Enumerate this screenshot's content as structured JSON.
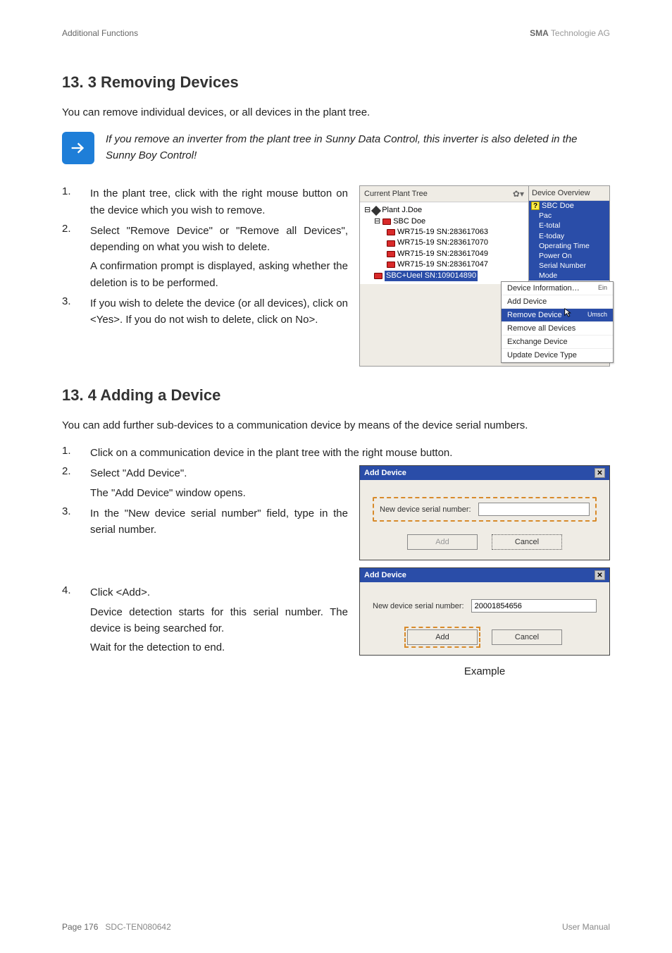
{
  "header": {
    "left": "Additional Functions",
    "right_bold": "SMA",
    "right_rest": " Technologie AG"
  },
  "section1": {
    "heading": "13. 3 Removing Devices",
    "intro": "You can remove individual devices, or all devices in the plant tree.",
    "note": "If you remove an inverter from the plant tree in Sunny Data Control, this inverter is also deleted in the Sunny Boy Control!",
    "steps": [
      {
        "n": "1.",
        "t": "In the plant tree, click with the right mouse button on the device which you wish to remove."
      },
      {
        "n": "2.",
        "t": "Select \"Remove Device\" or \"Remove all Devices\", depending on what you wish to delete.",
        "s": "A confirmation prompt is displayed, asking whether the deletion is to be performed."
      },
      {
        "n": "3.",
        "t": "If you wish to delete the device (or all devices), click on <Yes>. If you do not wish to delete, click on No>."
      }
    ]
  },
  "screenshot1": {
    "leftTitle": "Current Plant Tree",
    "rightTitle": "Device Overview",
    "root": "Plant J.Doe",
    "sbc": "SBC Doe",
    "inv": [
      "WR715-19 SN:283617063",
      "WR715-19 SN:283617070",
      "WR715-19 SN:283617049",
      "WR715-19 SN:283617047"
    ],
    "sel": "SBC+Ueel SN:109014890",
    "ovSel": "SBC Doe",
    "ovItems": [
      "Pac",
      "E-total",
      "E-today",
      "Operating Time",
      "Power On",
      "Serial Number",
      "Mode"
    ],
    "ctx": {
      "info": "Device Information…",
      "infoKey": "Ein",
      "add": "Add Device",
      "remove": "Remove Device",
      "removeKey": "Umsch",
      "removeAll": "Remove all Devices",
      "exchange": "Exchange Device",
      "update": "Update Device Type"
    }
  },
  "section2": {
    "heading": "13. 4 Adding a Device",
    "intro": "You can add further sub-devices to a communication device by means of the device serial numbers.",
    "steps": [
      {
        "n": "1.",
        "t": "Click on a communication device in the plant tree with the right mouse button."
      },
      {
        "n": "2.",
        "t": "Select \"Add Device\".",
        "s": "The \"Add Device\" window opens."
      },
      {
        "n": "3.",
        "t": "In the \"New device serial number\" field, type in the serial number."
      },
      {
        "n": "4.",
        "t": "Click <Add>.",
        "s1": "Device detection starts for this serial number. The device is being searched for.",
        "s2": "Wait for the detection to end."
      }
    ]
  },
  "dialog": {
    "title": "Add Device",
    "label": "New device serial number:",
    "value2": "20001854656",
    "add": "Add",
    "cancel": "Cancel",
    "example": "Example"
  },
  "footer": {
    "page": "Page 176",
    "code": "SDC-TEN080642",
    "right": "User Manual"
  }
}
